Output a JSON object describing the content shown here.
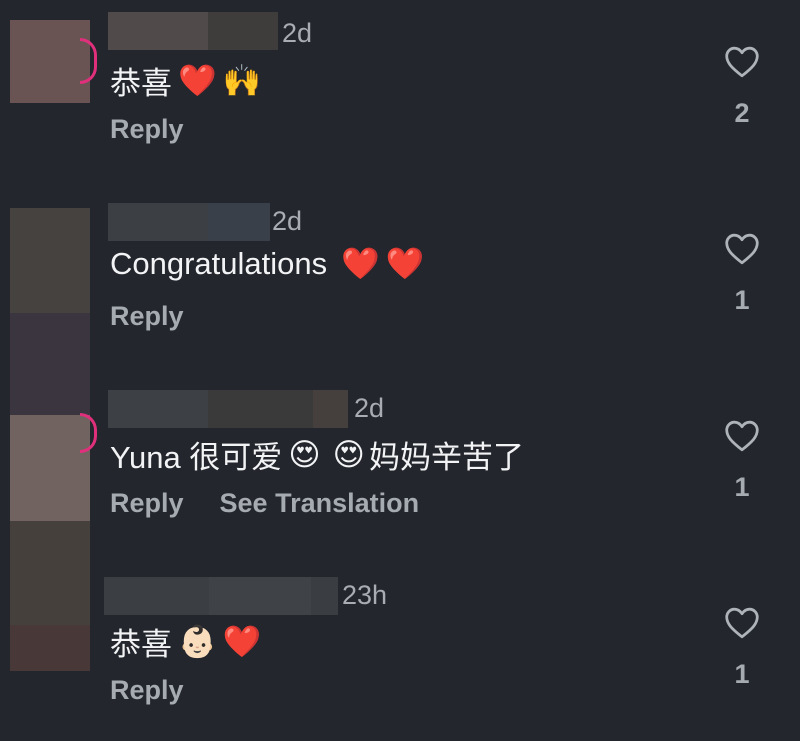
{
  "comments": [
    {
      "time": "2d",
      "text": "恭喜",
      "emojis": [
        "❤️",
        "🙌"
      ],
      "actions": [
        "Reply"
      ],
      "likes": "2"
    },
    {
      "time": "2d",
      "text": "Congratulations",
      "emojis": [
        "❤️",
        "❤️"
      ],
      "actions": [
        "Reply"
      ],
      "likes": "1"
    },
    {
      "time": "2d",
      "text": "Yuna 很可爱",
      "emojis": [
        "😍",
        "😍"
      ],
      "text_after": "妈妈辛苦了",
      "actions": [
        "Reply",
        "See Translation"
      ],
      "likes": "1"
    },
    {
      "time": "23h",
      "text": "恭喜",
      "emojis": [
        "👶🏻",
        "❤️"
      ],
      "actions": [
        "Reply"
      ],
      "likes": "1"
    }
  ],
  "colors": {
    "background": "#23262c",
    "story_ring": "#e0307c",
    "muted": "#a6abb2"
  },
  "icons": {
    "like": "heart-outline-icon"
  }
}
